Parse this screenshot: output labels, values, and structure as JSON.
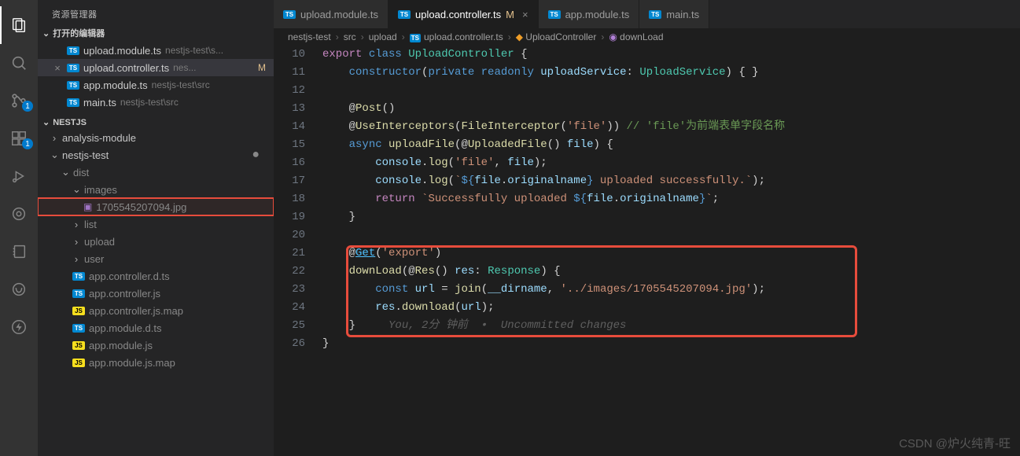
{
  "sidebar": {
    "title": "资源管理器",
    "sections": {
      "openEditors": {
        "label": "打开的编辑器",
        "items": [
          {
            "icon": "TS",
            "name": "upload.module.ts",
            "hint": "nestjs-test\\s..."
          },
          {
            "icon": "TS",
            "name": "upload.controller.ts",
            "hint": "nes...",
            "modified": "M",
            "active": true
          },
          {
            "icon": "TS",
            "name": "app.module.ts",
            "hint": "nestjs-test\\src"
          },
          {
            "icon": "TS",
            "name": "main.ts",
            "hint": "nestjs-test\\src"
          }
        ]
      },
      "workspace": {
        "label": "NESTJS"
      }
    },
    "tree": [
      {
        "depth": 0,
        "type": "dir",
        "open": false,
        "label": "analysis-module"
      },
      {
        "depth": 0,
        "type": "dir",
        "open": true,
        "label": "nestjs-test",
        "modified": true
      },
      {
        "depth": 1,
        "type": "dir",
        "open": true,
        "label": "dist",
        "faded": true
      },
      {
        "depth": 2,
        "type": "dir",
        "open": true,
        "label": "images",
        "faded": true
      },
      {
        "depth": 3,
        "type": "file",
        "icon": "img",
        "label": "1705545207094.jpg",
        "faded": true,
        "highlight": true
      },
      {
        "depth": 2,
        "type": "dir",
        "open": false,
        "label": "list",
        "faded": true
      },
      {
        "depth": 2,
        "type": "dir",
        "open": false,
        "label": "upload",
        "faded": true
      },
      {
        "depth": 2,
        "type": "dir",
        "open": false,
        "label": "user",
        "faded": true
      },
      {
        "depth": 2,
        "type": "file",
        "icon": "TS",
        "label": "app.controller.d.ts",
        "faded": true
      },
      {
        "depth": 2,
        "type": "file",
        "icon": "TS",
        "label": "app.controller.js",
        "faded": true
      },
      {
        "depth": 2,
        "type": "file",
        "icon": "JS",
        "label": "app.controller.js.map",
        "faded": true
      },
      {
        "depth": 2,
        "type": "file",
        "icon": "TS",
        "label": "app.module.d.ts",
        "faded": true
      },
      {
        "depth": 2,
        "type": "file",
        "icon": "JS",
        "label": "app.module.js",
        "faded": true
      },
      {
        "depth": 2,
        "type": "file",
        "icon": "JS",
        "label": "app.module.js.map",
        "faded": true
      }
    ]
  },
  "tabs": [
    {
      "icon": "TS",
      "label": "upload.module.ts"
    },
    {
      "icon": "TS",
      "label": "upload.controller.ts",
      "modified": "M",
      "active": true,
      "close": true
    },
    {
      "icon": "TS",
      "label": "app.module.ts"
    },
    {
      "icon": "TS",
      "label": "main.ts"
    }
  ],
  "breadcrumb": {
    "parts": [
      "nestjs-test",
      "src",
      "upload"
    ],
    "file": "upload.controller.ts",
    "class": "UploadController",
    "method": "downLoad"
  },
  "activity": {
    "scm_badge": "1",
    "ext_badge": "1"
  },
  "code": {
    "start": 10,
    "lines": [
      {
        "n": 10,
        "html": "<span class='tok-keyword2'>export</span> <span class='tok-keyword'>class</span> <span class='tok-class'>UploadController</span> {"
      },
      {
        "n": 11,
        "html": "    <span class='tok-keyword'>constructor</span>(<span class='tok-keyword'>private</span> <span class='tok-keyword'>readonly</span> <span class='tok-var'>uploadService</span>: <span class='tok-class'>UploadService</span>) { }"
      },
      {
        "n": 12,
        "html": ""
      },
      {
        "n": 13,
        "html": "    @<span class='tok-decorator'>Post</span>()"
      },
      {
        "n": 14,
        "html": "    @<span class='tok-decorator'>UseInterceptors</span>(<span class='tok-fn'>FileInterceptor</span>(<span class='tok-str'>'file'</span>)) <span class='tok-comment'>// 'file'为前端表单字段名称</span>"
      },
      {
        "n": 15,
        "html": "    <span class='tok-keyword'>async</span> <span class='tok-fn'>uploadFile</span>(@<span class='tok-decorator'>UploadedFile</span>() <span class='tok-var'>file</span>) {"
      },
      {
        "n": 16,
        "html": "        <span class='tok-var'>console</span>.<span class='tok-fn'>log</span>(<span class='tok-str'>'file'</span>, <span class='tok-var'>file</span>);"
      },
      {
        "n": 17,
        "html": "        <span class='tok-var'>console</span>.<span class='tok-fn'>log</span>(<span class='tok-str'>`</span><span class='tok-keyword'>${</span><span class='tok-var'>file</span>.<span class='tok-var'>originalname</span><span class='tok-keyword'>}</span><span class='tok-str'> uploaded successfully.`</span>);"
      },
      {
        "n": 18,
        "html": "        <span class='tok-keyword2'>return</span> <span class='tok-str'>`Successfully uploaded </span><span class='tok-keyword'>${</span><span class='tok-var'>file</span>.<span class='tok-var'>originalname</span><span class='tok-keyword'>}</span><span class='tok-str'>`</span>;"
      },
      {
        "n": 19,
        "html": "    }"
      },
      {
        "n": 20,
        "html": ""
      },
      {
        "n": 21,
        "html": "    @<span class='tok-link'>Get</span>(<span class='tok-str'>'export'</span>)"
      },
      {
        "n": 22,
        "html": "    <span class='tok-fn'>downLoad</span>(@<span class='tok-decorator'>Res</span>() <span class='tok-var'>res</span>: <span class='tok-class'>Response</span>) {"
      },
      {
        "n": 23,
        "html": "        <span class='tok-keyword'>const</span> <span class='tok-var'>url</span> = <span class='tok-fn'>join</span>(<span class='tok-var'>__dirname</span>, <span class='tok-str'>'../images/1705545207094.jpg'</span>);"
      },
      {
        "n": 24,
        "html": "        <span class='tok-var'>res</span>.<span class='tok-fn'>download</span>(<span class='tok-var'>url</span>);"
      },
      {
        "n": 25,
        "html": "    }     <span class='tok-blame'>You, 2分 钟前  •  Uncommitted changes</span>"
      },
      {
        "n": 26,
        "html": "}"
      }
    ]
  },
  "watermark": "CSDN @炉火纯青-旺"
}
